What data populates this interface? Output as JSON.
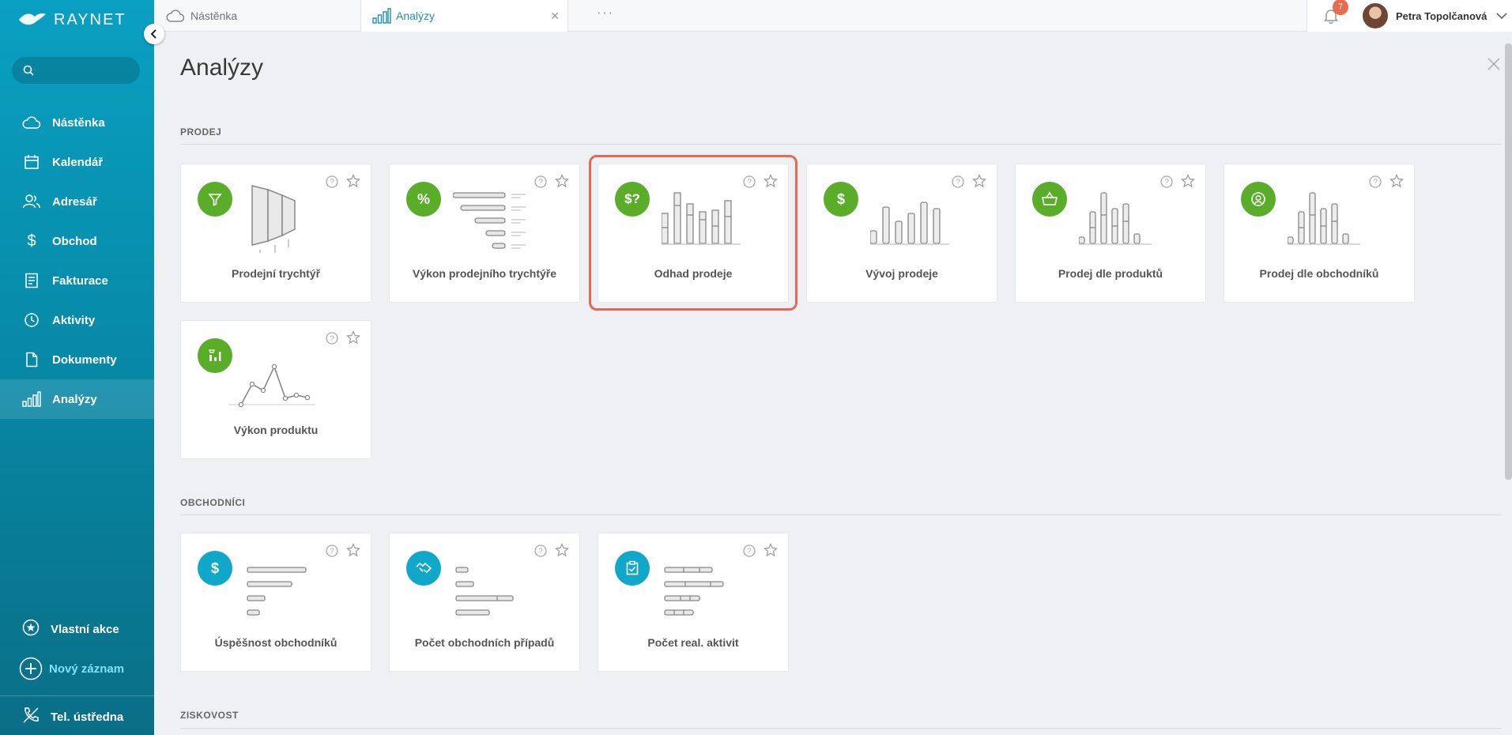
{
  "app": {
    "logo": "RAYNET"
  },
  "sidebar": {
    "search_placeholder": "",
    "items": [
      {
        "label": "Nástěnka",
        "icon": "cloud-icon"
      },
      {
        "label": "Kalendář",
        "icon": "calendar-icon"
      },
      {
        "label": "Adresář",
        "icon": "contacts-icon"
      },
      {
        "label": "Obchod",
        "icon": "dollar-icon"
      },
      {
        "label": "Fakturace",
        "icon": "invoice-icon"
      },
      {
        "label": "Aktivity",
        "icon": "clock-icon"
      },
      {
        "label": "Dokumenty",
        "icon": "document-icon"
      },
      {
        "label": "Analýzy",
        "icon": "bar-chart-icon",
        "active": true
      }
    ],
    "bottom": {
      "custom_actions": "Vlastní akce",
      "new_record": "Nový záznam",
      "phone": "Tel. ústředna"
    }
  },
  "tabs": [
    {
      "label": "Nástěnka"
    },
    {
      "label": "Analýzy",
      "active": true
    }
  ],
  "topbar": {
    "more": "···",
    "notifications": "7",
    "user_name": "Petra Topolčanová"
  },
  "page": {
    "title": "Analýzy"
  },
  "sections": [
    {
      "title": "PRODEJ",
      "cards": [
        {
          "label": "Prodejní trychtýř",
          "icon": "funnel-icon"
        },
        {
          "label": "Výkon prodejního trychtýře",
          "icon": "percent-icon"
        },
        {
          "label": "Odhad prodeje",
          "icon": "dollar-question-icon",
          "highlighted": true
        },
        {
          "label": "Vývoj prodeje",
          "icon": "dollar-icon"
        },
        {
          "label": "Prodej dle produktů",
          "icon": "basket-icon"
        },
        {
          "label": "Prodej dle obchodníků",
          "icon": "user-circle-icon"
        },
        {
          "label": "Výkon produktu",
          "icon": "product-chart-icon"
        }
      ]
    },
    {
      "title": "OBCHODNÍCI",
      "cards": [
        {
          "label": "Úspěšnost obchodníků",
          "icon": "dollar-icon"
        },
        {
          "label": "Počet obchodních případů",
          "icon": "handshake-icon"
        },
        {
          "label": "Počet real. aktivit",
          "icon": "clipboard-check-icon"
        }
      ]
    },
    {
      "title": "ZISKOVOST"
    }
  ],
  "colors": {
    "sidebar": "#0aa0c2",
    "green": "#5aad28",
    "blue": "#11a7c9",
    "highlight": "#e56a55",
    "active_tab": "#1a8fb0"
  }
}
